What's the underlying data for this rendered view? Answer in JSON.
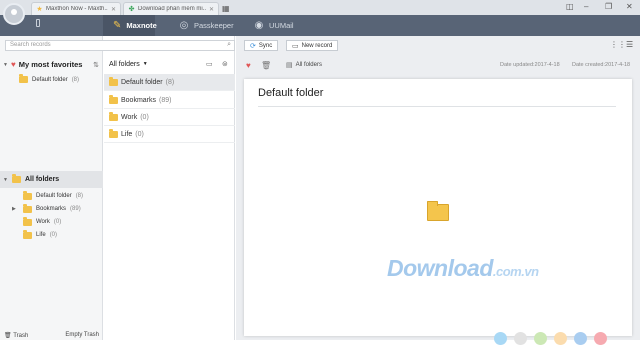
{
  "browser": {
    "tabs": [
      {
        "title": "Maxthon Now - Maxth...",
        "icon": "star-icon"
      },
      {
        "title": "Download phần mềm mi...",
        "icon": "leaf-icon"
      }
    ]
  },
  "appbar": {
    "tabs": [
      {
        "label": "Maxnote",
        "icon": "maxnote-icon",
        "active": true
      },
      {
        "label": "Passkeeper",
        "icon": "fingerprint-icon",
        "active": false
      },
      {
        "label": "UUMail",
        "icon": "mail-icon",
        "active": false
      }
    ]
  },
  "search": {
    "placeholder": "Search records"
  },
  "toolbar": {
    "sync_label": "Sync",
    "new_record_label": "New record"
  },
  "favorites": {
    "heading": "My most favorites",
    "items": [
      {
        "label": "Default folder",
        "count": "(8)"
      }
    ]
  },
  "all_folders": {
    "heading": "All folders",
    "items": [
      {
        "label": "Default folder",
        "count": "(8)"
      },
      {
        "label": "Bookmarks",
        "count": "(89)"
      },
      {
        "label": "Work",
        "count": "(0)"
      },
      {
        "label": "Life",
        "count": "(0)"
      }
    ]
  },
  "footer": {
    "trash_label": "Trash",
    "empty_trash_label": "Empty Trash"
  },
  "middle": {
    "dropdown_label": "All folders",
    "items": [
      {
        "label": "Default folder",
        "count": "(8)",
        "selected": true
      },
      {
        "label": "Bookmarks",
        "count": "(89)",
        "selected": false
      },
      {
        "label": "Work",
        "count": "(0)",
        "selected": false
      },
      {
        "label": "Life",
        "count": "(0)",
        "selected": false
      }
    ]
  },
  "note": {
    "breadcrumb": "All folders",
    "date_updated": "Date updated:2017-4-18",
    "date_created": "Date created:2017-4-18",
    "title": "Default folder"
  },
  "watermark": {
    "text": "Download",
    "domain": ".com.vn"
  },
  "colors": {
    "appbar": "#586476",
    "folder": "#f2c24a",
    "heart": "#e05656",
    "dots": [
      "#a8d8f5",
      "#e2e2e2",
      "#cce8b5",
      "#fbdcae",
      "#a9cdf0",
      "#f6aab0"
    ]
  }
}
